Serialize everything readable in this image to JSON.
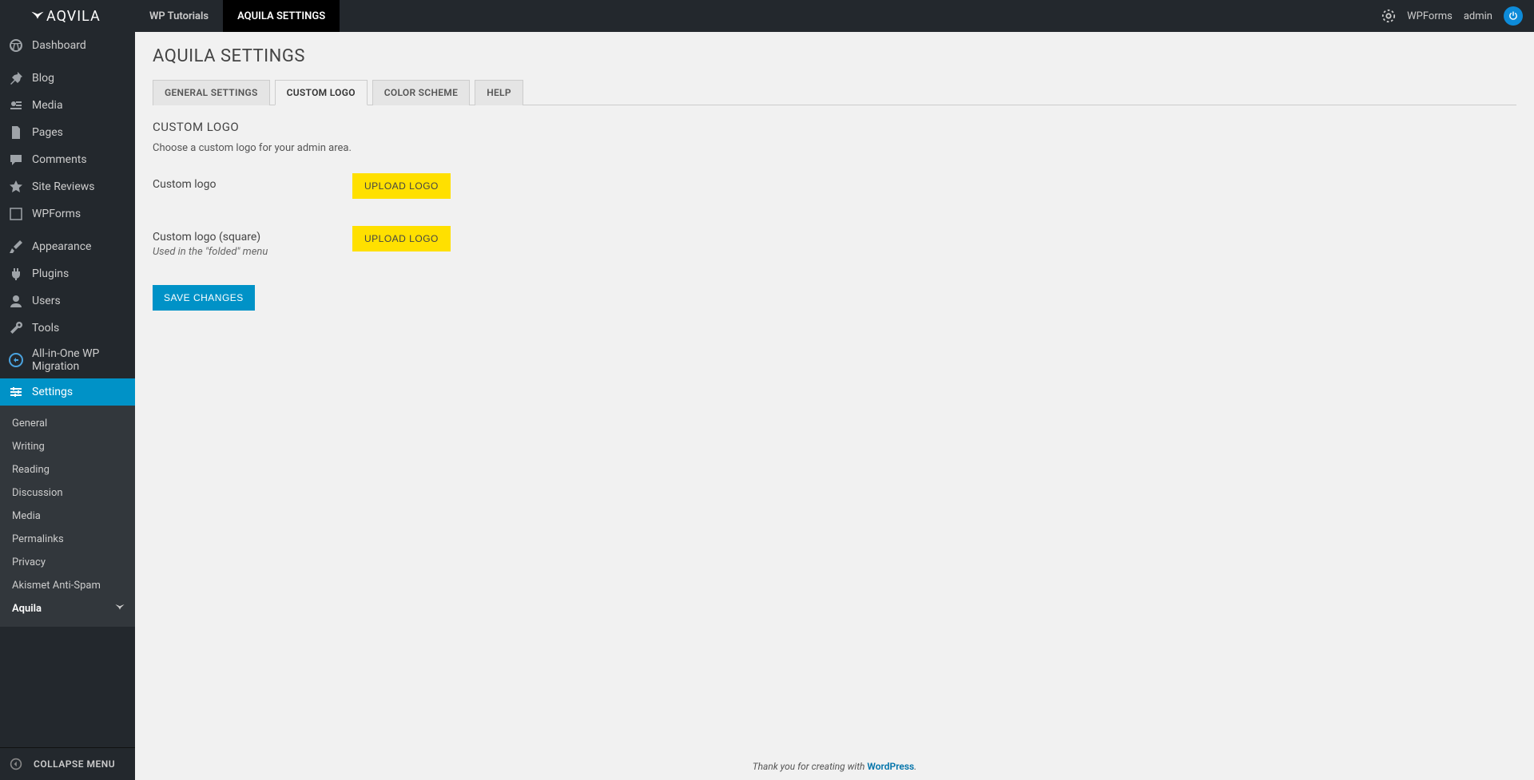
{
  "brand": "AQVILA",
  "topbar": {
    "tabs": [
      {
        "label": "WP Tutorials",
        "active": false
      },
      {
        "label": "AQUILA SETTINGS",
        "active": true
      }
    ],
    "right": {
      "wpforms": "WPForms",
      "admin": "admin"
    }
  },
  "sidebar": {
    "items": [
      {
        "label": "Dashboard",
        "icon": "dashboard"
      },
      {
        "label": "Blog",
        "icon": "pin"
      },
      {
        "label": "Media",
        "icon": "media"
      },
      {
        "label": "Pages",
        "icon": "pages"
      },
      {
        "label": "Comments",
        "icon": "comments"
      },
      {
        "label": "Site Reviews",
        "icon": "star"
      },
      {
        "label": "WPForms",
        "icon": "form"
      },
      {
        "label": "Appearance",
        "icon": "brush"
      },
      {
        "label": "Plugins",
        "icon": "plug"
      },
      {
        "label": "Users",
        "icon": "user"
      },
      {
        "label": "Tools",
        "icon": "wrench"
      },
      {
        "label": "All-in-One WP Migration",
        "icon": "migrate"
      },
      {
        "label": "Settings",
        "icon": "settings",
        "current": true
      }
    ],
    "submenu": [
      {
        "label": "General"
      },
      {
        "label": "Writing"
      },
      {
        "label": "Reading"
      },
      {
        "label": "Discussion"
      },
      {
        "label": "Media"
      },
      {
        "label": "Permalinks"
      },
      {
        "label": "Privacy"
      },
      {
        "label": "Akismet Anti-Spam"
      },
      {
        "label": "Aquila",
        "current": true
      }
    ],
    "collapse": "COLLAPSE MENU"
  },
  "page": {
    "title": "AQUILA SETTINGS",
    "tabs": [
      {
        "label": "GENERAL SETTINGS"
      },
      {
        "label": "CUSTOM LOGO",
        "active": true
      },
      {
        "label": "COLOR SCHEME"
      },
      {
        "label": "HELP"
      }
    ],
    "section": {
      "title": "CUSTOM LOGO",
      "desc": "Choose a custom logo for your admin area."
    },
    "fields": [
      {
        "label": "Custom logo",
        "sub": "",
        "button": "UPLOAD LOGO"
      },
      {
        "label": "Custom logo (square)",
        "sub": "Used in the \"folded\" menu",
        "button": "UPLOAD LOGO"
      }
    ],
    "save": "SAVE CHANGES"
  },
  "footer": {
    "text": "Thank you for creating with ",
    "link": "WordPress",
    "period": "."
  }
}
